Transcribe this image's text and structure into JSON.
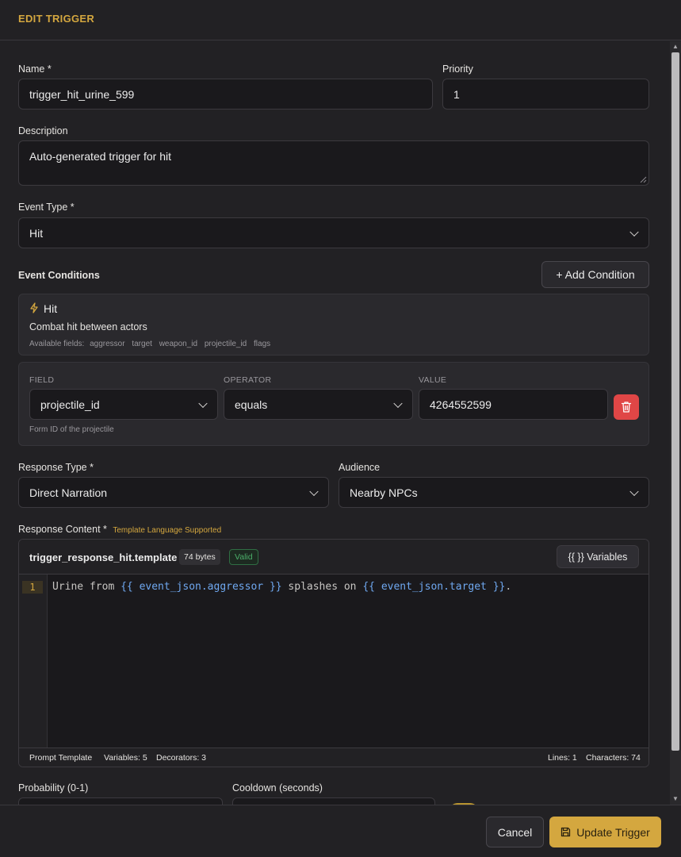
{
  "header": {
    "title": "EDIT TRIGGER"
  },
  "form": {
    "name_label": "Name *",
    "name_value": "trigger_hit_urine_599",
    "priority_label": "Priority",
    "priority_value": "1",
    "description_label": "Description",
    "description_value": "Auto-generated trigger for hit",
    "event_type_label": "Event Type *",
    "event_type_value": "Hit",
    "event_conditions_label": "Event Conditions",
    "add_condition_label": "+ Add Condition",
    "event_info": {
      "title": "Hit",
      "description": "Combat hit between actors",
      "fields_label": "Available fields:",
      "fields": [
        "aggressor",
        "target",
        "weapon_id",
        "projectile_id",
        "flags"
      ]
    },
    "condition": {
      "field_header": "FIELD",
      "operator_header": "OPERATOR",
      "value_header": "VALUE",
      "field_value": "projectile_id",
      "operator_value": "equals",
      "value": "4264552599",
      "hint": "Form ID of the projectile"
    },
    "response_type_label": "Response Type *",
    "response_type_value": "Direct Narration",
    "audience_label": "Audience",
    "audience_value": "Nearby NPCs",
    "response_content_label": "Response Content *",
    "template_supported": "Template Language Supported",
    "editor": {
      "filename": "trigger_response_hit.template",
      "size_badge": "74 bytes",
      "valid_badge": "Valid",
      "variables_button": "{{ }} Variables",
      "line_number": "1",
      "code_tokens": [
        {
          "text": "Urine from ",
          "kind": "plain"
        },
        {
          "text": "{{",
          "kind": "brace"
        },
        {
          "text": " event_json.aggressor ",
          "kind": "var"
        },
        {
          "text": "}}",
          "kind": "brace"
        },
        {
          "text": " splashes on ",
          "kind": "plain"
        },
        {
          "text": "{{",
          "kind": "brace"
        },
        {
          "text": " event_json.target ",
          "kind": "var"
        },
        {
          "text": "}}",
          "kind": "brace"
        },
        {
          "text": ".",
          "kind": "plain"
        }
      ],
      "status_left": [
        "Prompt Template",
        "Variables: 5",
        "Decorators: 3"
      ],
      "status_right": [
        "Lines: 1",
        "Characters: 74"
      ]
    },
    "probability_label": "Probability (0-1)",
    "cooldown_label": "Cooldown (seconds)"
  },
  "footer": {
    "cancel_label": "Cancel",
    "update_label": "Update Trigger"
  },
  "colors": {
    "accent": "#d4a73f",
    "danger": "#e04646",
    "valid": "#4caf6a",
    "code_var": "#6fa8f0"
  }
}
